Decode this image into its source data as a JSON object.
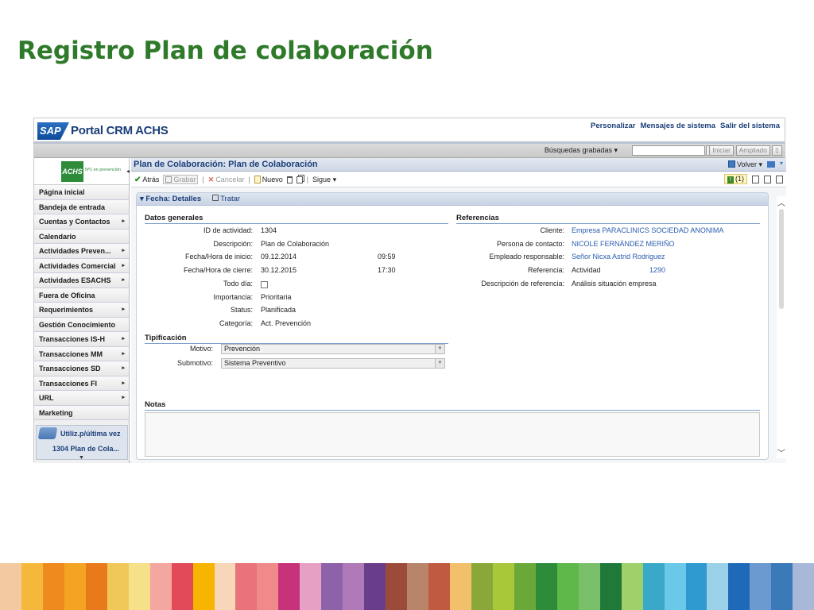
{
  "slide": {
    "title": "Registro Plan de colaboración"
  },
  "header": {
    "logo_text": "SAP",
    "portal_name": "Portal CRM ACHS",
    "links": [
      "Personalizar",
      "Mensajes de sistema",
      "Salir del sistema"
    ]
  },
  "searchbar": {
    "saved_searches": "Búsquedas grabadas ▾",
    "search_value": "",
    "iniciar": "Iniciar",
    "ampliado": "Ampliado"
  },
  "nav": {
    "logo": "ACHS",
    "logo_tag": "Nº1 en prevención",
    "items": [
      {
        "label": "Página inicial",
        "arrow": ""
      },
      {
        "label": "Bandeja de entrada",
        "arrow": ""
      },
      {
        "label": "Cuentas y Contactos",
        "arrow": "▸"
      },
      {
        "label": "Calendario",
        "arrow": ""
      },
      {
        "label": "Actividades Preven...",
        "arrow": "▸"
      },
      {
        "label": "Actividades Comercial",
        "arrow": "▸"
      },
      {
        "label": "Actividades ESACHS",
        "arrow": "▸"
      },
      {
        "label": "Fuera de Oficina",
        "arrow": ""
      },
      {
        "label": "Requerimientos",
        "arrow": "▸"
      },
      {
        "label": "Gestión Conocimiento",
        "arrow": ""
      },
      {
        "label": "Transacciones IS-H",
        "arrow": "▸"
      },
      {
        "label": "Transacciones MM",
        "arrow": "▸"
      },
      {
        "label": "Transacciones SD",
        "arrow": "▸"
      },
      {
        "label": "Transacciones FI",
        "arrow": "▸"
      },
      {
        "label": "URL",
        "arrow": "▸"
      },
      {
        "label": "Marketing",
        "arrow": ""
      }
    ],
    "recent_title": "Utiliz.p/última vez",
    "recent_item": "1304 Plan de Cola..."
  },
  "main": {
    "page_title": "Plan de Colaboración: Plan de Colaboración",
    "volver": "Volver ▾",
    "toolbar": {
      "atras": "Atrás",
      "grabar": "Grabar",
      "cancelar": "Cancelar",
      "nuevo": "Nuevo",
      "sigue": "Sigue ▾",
      "alerts": "(1)"
    },
    "panel": {
      "title": "▾ Fecha: Detalles",
      "tratar": "Tratar",
      "general": {
        "heading": "Datos generales",
        "fields": [
          {
            "label": "ID de actividad:",
            "value": "1304",
            "extra": ""
          },
          {
            "label": "Descripción:",
            "value": "Plan de Colaboración",
            "extra": ""
          },
          {
            "label": "Fecha/Hora de inicio:",
            "value": "09.12.2014",
            "extra": "09:59"
          },
          {
            "label": "Fecha/Hora de cierre:",
            "value": "30.12.2015",
            "extra": "17:30"
          },
          {
            "label": "Todo día:",
            "value": "",
            "extra": ""
          },
          {
            "label": "Importancia:",
            "value": "Prioritaria",
            "extra": ""
          },
          {
            "label": "Status:",
            "value": "Planificada",
            "extra": ""
          },
          {
            "label": "Categoría:",
            "value": "Act. Prevención",
            "extra": ""
          }
        ]
      },
      "referencias": {
        "heading": "Referencias",
        "fields": [
          {
            "label": "Cliente:",
            "value": "Empresa PARACLINICS SOCIEDAD ANONIMA",
            "extra": ""
          },
          {
            "label": "Persona de contacto:",
            "value": "NICOLE FERNÁNDEZ MERIÑO",
            "extra": ""
          },
          {
            "label": "Empleado responsable:",
            "value": "Señor Nicxa Astrid Rodriguez",
            "extra": ""
          },
          {
            "label": "Referencia:",
            "value": "Actividad",
            "extra": "1290"
          },
          {
            "label": "Descripción de referencia:",
            "value": "Análisis situación empresa",
            "extra": ""
          }
        ]
      },
      "tipificacion": {
        "heading": "Tipificación",
        "motivo_label": "Motivo:",
        "motivo_value": "Prevención",
        "submotivo_label": "Submotivo:",
        "submotivo_value": "Sistema Preventivo"
      },
      "notas": {
        "heading": "Notas",
        "value": ""
      }
    }
  },
  "stripe_colors": [
    "#f2c9a0",
    "#f6b83a",
    "#ef8a1f",
    "#f4a323",
    "#e87a1c",
    "#f0c85a",
    "#f7e08a",
    "#f4a6a0",
    "#e24a5a",
    "#f7b400",
    "#f8d6b8",
    "#e8737a",
    "#f08a8a",
    "#c6337a",
    "#e6a0c4",
    "#8d62a8",
    "#b07ab8",
    "#6a3d8a",
    "#9c4a3a",
    "#b8846a",
    "#c05a40",
    "#f2c06a",
    "#8aa83a",
    "#a8c83a",
    "#6aa83a",
    "#2e8b3a",
    "#5fb84a",
    "#7ac06a",
    "#1f7a3a",
    "#a0d06a",
    "#3aa8c8",
    "#6ac8e8",
    "#2e9ad0",
    "#9ad0e8",
    "#1f6ab8",
    "#6a9ad0",
    "#3a7ab8",
    "#a8b8d8"
  ]
}
